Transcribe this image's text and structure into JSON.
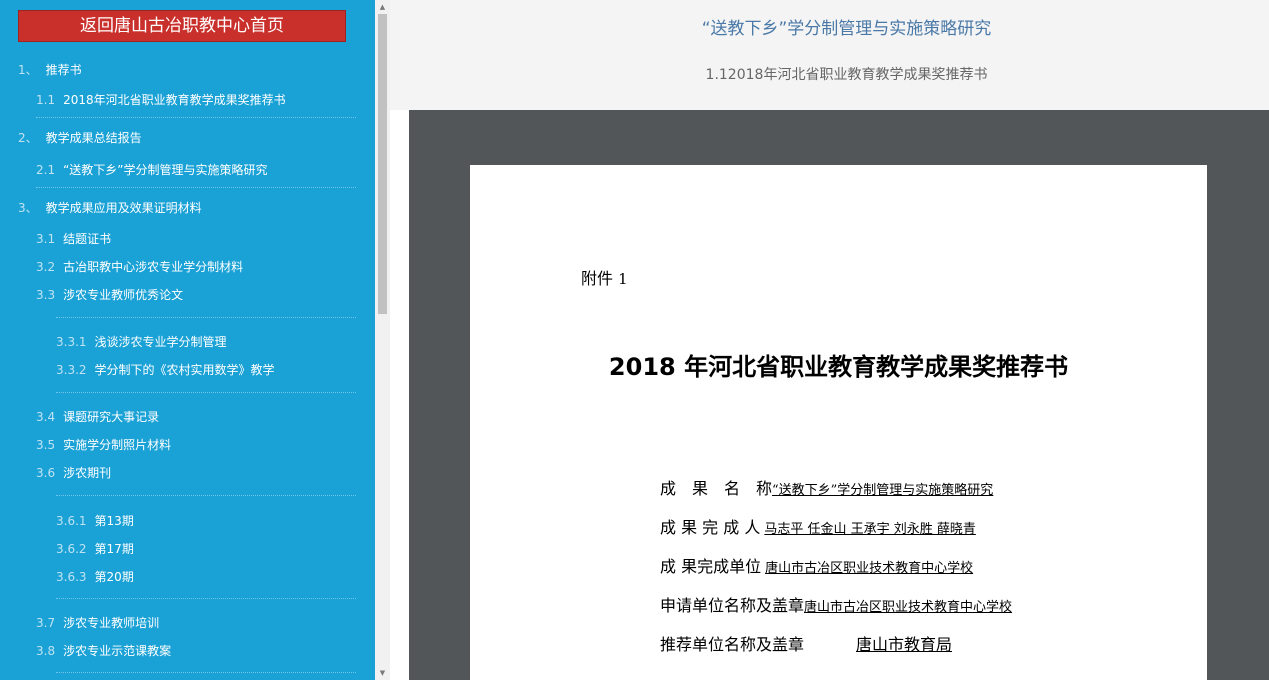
{
  "sidebar": {
    "home_label": "返回唐山古冶职教中心首页",
    "items": [
      {
        "num": "1、",
        "label": "推荐书"
      },
      {
        "num": "1.1",
        "label": "2018年河北省职业教育教学成果奖推荐书"
      },
      {
        "num": "2、",
        "label": "教学成果总结报告"
      },
      {
        "num": "2.1",
        "label": "“送教下乡”学分制管理与实施策略研究"
      },
      {
        "num": "3、",
        "label": "教学成果应用及效果证明材料"
      },
      {
        "num": "3.1",
        "label": "结题证书"
      },
      {
        "num": "3.2",
        "label": "古冶职教中心涉农专业学分制材料"
      },
      {
        "num": "3.3",
        "label": "涉农专业教师优秀论文"
      },
      {
        "num": "3.3.1",
        "label": "浅谈涉农专业学分制管理"
      },
      {
        "num": "3.3.2",
        "label": "学分制下的《农村实用数学》教学"
      },
      {
        "num": "3.4",
        "label": "课题研究大事记录"
      },
      {
        "num": "3.5",
        "label": "实施学分制照片材料"
      },
      {
        "num": "3.6",
        "label": "涉农期刊"
      },
      {
        "num": "3.6.1",
        "label": "第13期"
      },
      {
        "num": "3.6.2",
        "label": "第17期"
      },
      {
        "num": "3.6.3",
        "label": "第20期"
      },
      {
        "num": "3.7",
        "label": "涉农专业教师培训"
      },
      {
        "num": "3.8",
        "label": "涉农专业示范课教案"
      }
    ]
  },
  "header": {
    "title": "“送教下乡”学分制管理与实施策略研究",
    "subtitle": "1.12018年河北省职业教育教学成果奖推荐书"
  },
  "document": {
    "attachment_label": "附件",
    "attachment_number": "1",
    "title": "2018 年河北省职业教育教学成果奖推荐书",
    "fields": [
      {
        "label": "成　果　名　称",
        "value": "“送教下乡”学分制管理与实施策略研究"
      },
      {
        "label": "成 果 完 成 人",
        "value": "马志平  任金山  王承宇  刘永胜  薛晓青"
      },
      {
        "label": "成 果完成单位",
        "value": "唐山市古冶区职业技术教育中心学校"
      },
      {
        "label": "申请单位名称及盖章",
        "value": "唐山市古冶区职业技术教育中心学校"
      },
      {
        "label": "推荐单位名称及盖章",
        "value": "唐山市教育局"
      }
    ]
  },
  "colors": {
    "sidebar_bg": "#1aa1d6",
    "home_button_bg": "#c9302c",
    "viewer_bg": "#525659",
    "title_color": "#4a79a8"
  }
}
